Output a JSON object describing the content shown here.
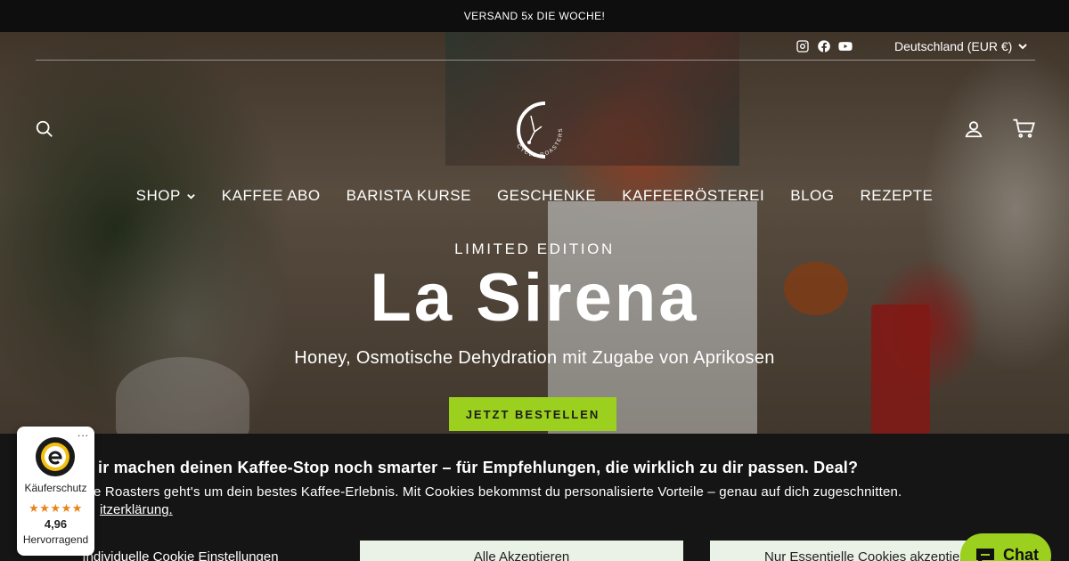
{
  "announcement": {
    "text": "VERSAND 5x DIE WOCHE!"
  },
  "header": {
    "social": [
      {
        "name": "instagram-icon"
      },
      {
        "name": "facebook-icon"
      },
      {
        "name": "youtube-icon"
      }
    ],
    "country_selector": "Deutschland (EUR €)",
    "logo_text": "CYCLE ROASTERS"
  },
  "nav": {
    "items": [
      {
        "label": "SHOP",
        "has_dropdown": true
      },
      {
        "label": "KAFFEE ABO"
      },
      {
        "label": "BARISTA KURSE"
      },
      {
        "label": "GESCHENKE"
      },
      {
        "label": "KAFFEERÖSTEREI"
      },
      {
        "label": "BLOG"
      },
      {
        "label": "REZEPTE"
      }
    ]
  },
  "hero": {
    "eyebrow": "LIMITED EDITION",
    "headline": "La Sirena",
    "subline": "Honey, Osmotische Dehydration mit Zugabe von Aprikosen",
    "cta_label": "JETZT BESTELLEN",
    "cta_color": "#9bd01e"
  },
  "cookie_banner": {
    "title": "ir machen deinen Kaffee-Stop noch smarter – für Empfehlungen, die wirklich zu dir passen. Deal?",
    "text": "e Roasters geht's um dein bestes Kaffee-Erlebnis. Mit Cookies bekommst du personalisierte Vorteile – genau auf dich zugeschnitten.",
    "link": "itzerklärung.",
    "buttons": {
      "settings": "Individuelle Cookie Einstellungen",
      "accept": "Alle Akzeptieren",
      "essential": "Nur Essentielle Cookies akzeptieren"
    }
  },
  "trust_badge": {
    "label": "Käuferschutz",
    "stars": "★★★★★",
    "score": "4,96",
    "rating": "Hervorragend",
    "menu": "..."
  },
  "chat": {
    "label": "Chat"
  }
}
